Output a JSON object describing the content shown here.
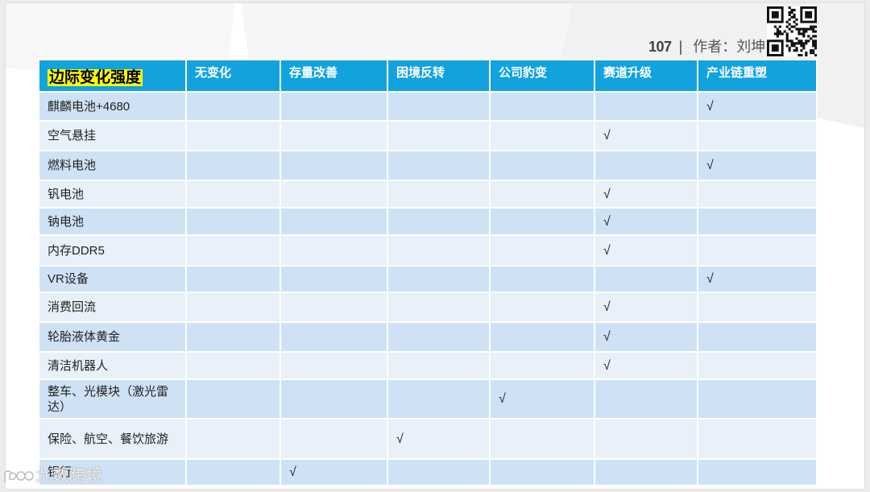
{
  "header": {
    "page_number": "107",
    "separator": "|",
    "author": "作者：刘坤"
  },
  "table": {
    "columns": [
      "边际变化强度",
      "无变化",
      "存量改善",
      "困境反转",
      "公司豹变",
      "赛道升级",
      "产业链重塑"
    ],
    "rows": [
      {
        "name": "麒麟电池+4680",
        "cells": [
          "",
          "",
          "",
          "",
          "",
          "√"
        ]
      },
      {
        "name": "空气悬挂",
        "cells": [
          "",
          "",
          "",
          "",
          "√",
          ""
        ]
      },
      {
        "name": "燃料电池",
        "cells": [
          "",
          "",
          "",
          "",
          "",
          "√"
        ]
      },
      {
        "name": "钒电池",
        "cells": [
          "",
          "",
          "",
          "",
          "√",
          ""
        ]
      },
      {
        "name": "钠电池",
        "cells": [
          "",
          "",
          "",
          "",
          "√",
          ""
        ]
      },
      {
        "name": "内存DDR5",
        "cells": [
          "",
          "",
          "",
          "",
          "√",
          ""
        ]
      },
      {
        "name": "VR设备",
        "cells": [
          "",
          "",
          "",
          "",
          "",
          "√"
        ]
      },
      {
        "name": "消费回流",
        "cells": [
          "",
          "",
          "",
          "",
          "√",
          ""
        ]
      },
      {
        "name": "轮胎液体黄金",
        "cells": [
          "",
          "",
          "",
          "",
          "√",
          ""
        ]
      },
      {
        "name": "清洁机器人",
        "cells": [
          "",
          "",
          "",
          "",
          "√",
          ""
        ]
      },
      {
        "name": "整车、光模块（激光雷达）",
        "cells": [
          "",
          "",
          "",
          "√",
          "",
          ""
        ]
      },
      {
        "name": "保险、航空、餐饮旅游",
        "cells": [
          "",
          "",
          "√",
          "",
          "",
          ""
        ]
      },
      {
        "name": "银行",
        "cells": [
          "",
          "√",
          "",
          "",
          "",
          ""
        ]
      }
    ]
  },
  "watermark": {
    "text": "九数跨境"
  },
  "colors": {
    "header_bg": "#12a3df",
    "row_odd": "#cfe2f5",
    "row_even": "#e8f0f9",
    "highlight": "#ffff00"
  },
  "icons": {
    "qr": "qr-code-icon",
    "watermark_logo": "watermark-logo-icon"
  }
}
